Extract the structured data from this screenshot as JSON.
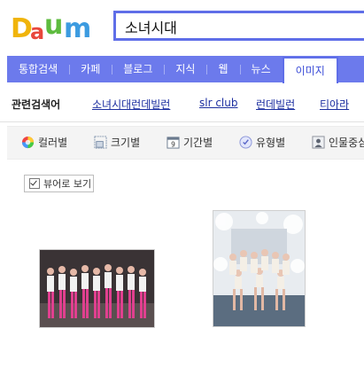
{
  "logo": {
    "text": "Daum",
    "colors": [
      "#f0b40b",
      "#3c9be0",
      "#5dbb3e",
      "#e8473c"
    ]
  },
  "search": {
    "value": "소녀시대",
    "border_color": "#5f6ee8"
  },
  "tabs": [
    {
      "label": "통합검색",
      "active": false
    },
    {
      "label": "카페",
      "active": false
    },
    {
      "label": "블로그",
      "active": false
    },
    {
      "label": "지식",
      "active": false
    },
    {
      "label": "웹",
      "active": false
    },
    {
      "label": "뉴스",
      "active": false
    },
    {
      "label": "이미지",
      "active": true
    }
  ],
  "related": {
    "title": "관련검색어",
    "links": [
      "소녀시대런데빌런",
      "slr club",
      "런데빌런",
      "티아라"
    ]
  },
  "filters": [
    {
      "label": "컬러별",
      "icon": "color-wheel-icon"
    },
    {
      "label": "크기별",
      "icon": "size-icon"
    },
    {
      "label": "기간별",
      "icon": "calendar-icon"
    },
    {
      "label": "유형별",
      "icon": "type-icon"
    },
    {
      "label": "인물중심",
      "icon": "person-icon"
    }
  ],
  "viewer": {
    "label": "뷰어로 보기",
    "checked": true
  },
  "results": [
    {
      "name": "result-image-1"
    },
    {
      "name": "result-image-2"
    }
  ],
  "colors": {
    "tab_bar": "#6c7aec",
    "link": "#1d2fa0"
  }
}
